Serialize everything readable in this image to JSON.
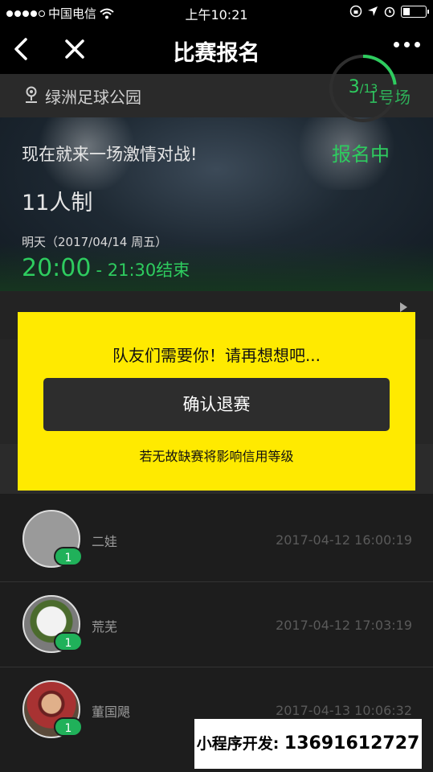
{
  "status_bar": {
    "carrier": "中国电信",
    "time": "上午10:21"
  },
  "nav": {
    "title": "比赛报名"
  },
  "venue": {
    "name": "绿洲足球公园",
    "field": "1号场"
  },
  "match": {
    "slogan": "现在就来一场激情对战!",
    "format": "11人制",
    "date": "明天（2017/04/14 周五）",
    "start_time": "20:00",
    "end_time": "- 21:30结束",
    "signed_count": "3",
    "signed_total": "/13",
    "signed_fraction": 0.23,
    "status": "报名中"
  },
  "modal": {
    "message": "队友们需要你！请再想想吧...",
    "confirm_label": "确认退赛",
    "note": "若无故缺赛将影响信用等级"
  },
  "participants": [
    {
      "name": "二娃",
      "time": "2017-04-12 16:00:19",
      "badge": "1",
      "avatar": "default"
    },
    {
      "name": "荒芜",
      "time": "2017-04-12 17:03:19",
      "badge": "1",
      "avatar": "joker"
    },
    {
      "name": "董国飓",
      "time": "2017-04-13 10:06:32",
      "badge": "1",
      "avatar": "kid"
    }
  ],
  "watermark": {
    "label": "小程序开发:",
    "phone": "13691612727"
  },
  "colors": {
    "accent_green": "#2ecc5f",
    "modal_yellow": "#ffea00",
    "background": "#1d1d1d"
  }
}
